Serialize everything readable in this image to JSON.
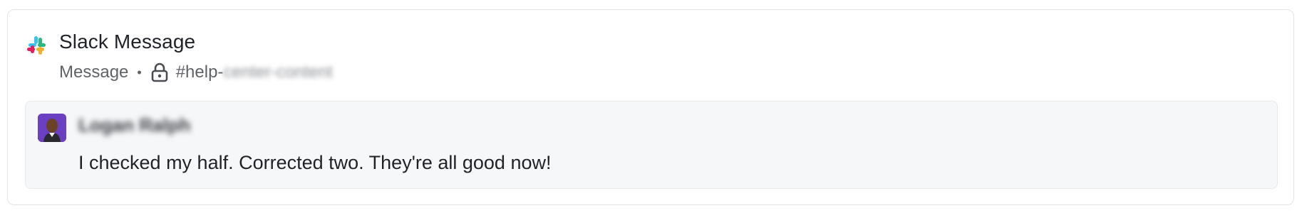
{
  "card": {
    "title": "Slack Message",
    "meta_type": "Message",
    "separator": "•",
    "channel_prefix": "#help-",
    "channel_suffix": "center-content"
  },
  "message": {
    "author": "Logan Ralph",
    "text": "I checked my half. Corrected two. They're all good now!"
  },
  "icons": [
    "slack-logo-icon",
    "lock-icon",
    "avatar-photo"
  ],
  "colors": {
    "avatar_bg": "#6a3fc1",
    "message_bg": "#f6f7f9",
    "border": "#e1e3e6"
  }
}
